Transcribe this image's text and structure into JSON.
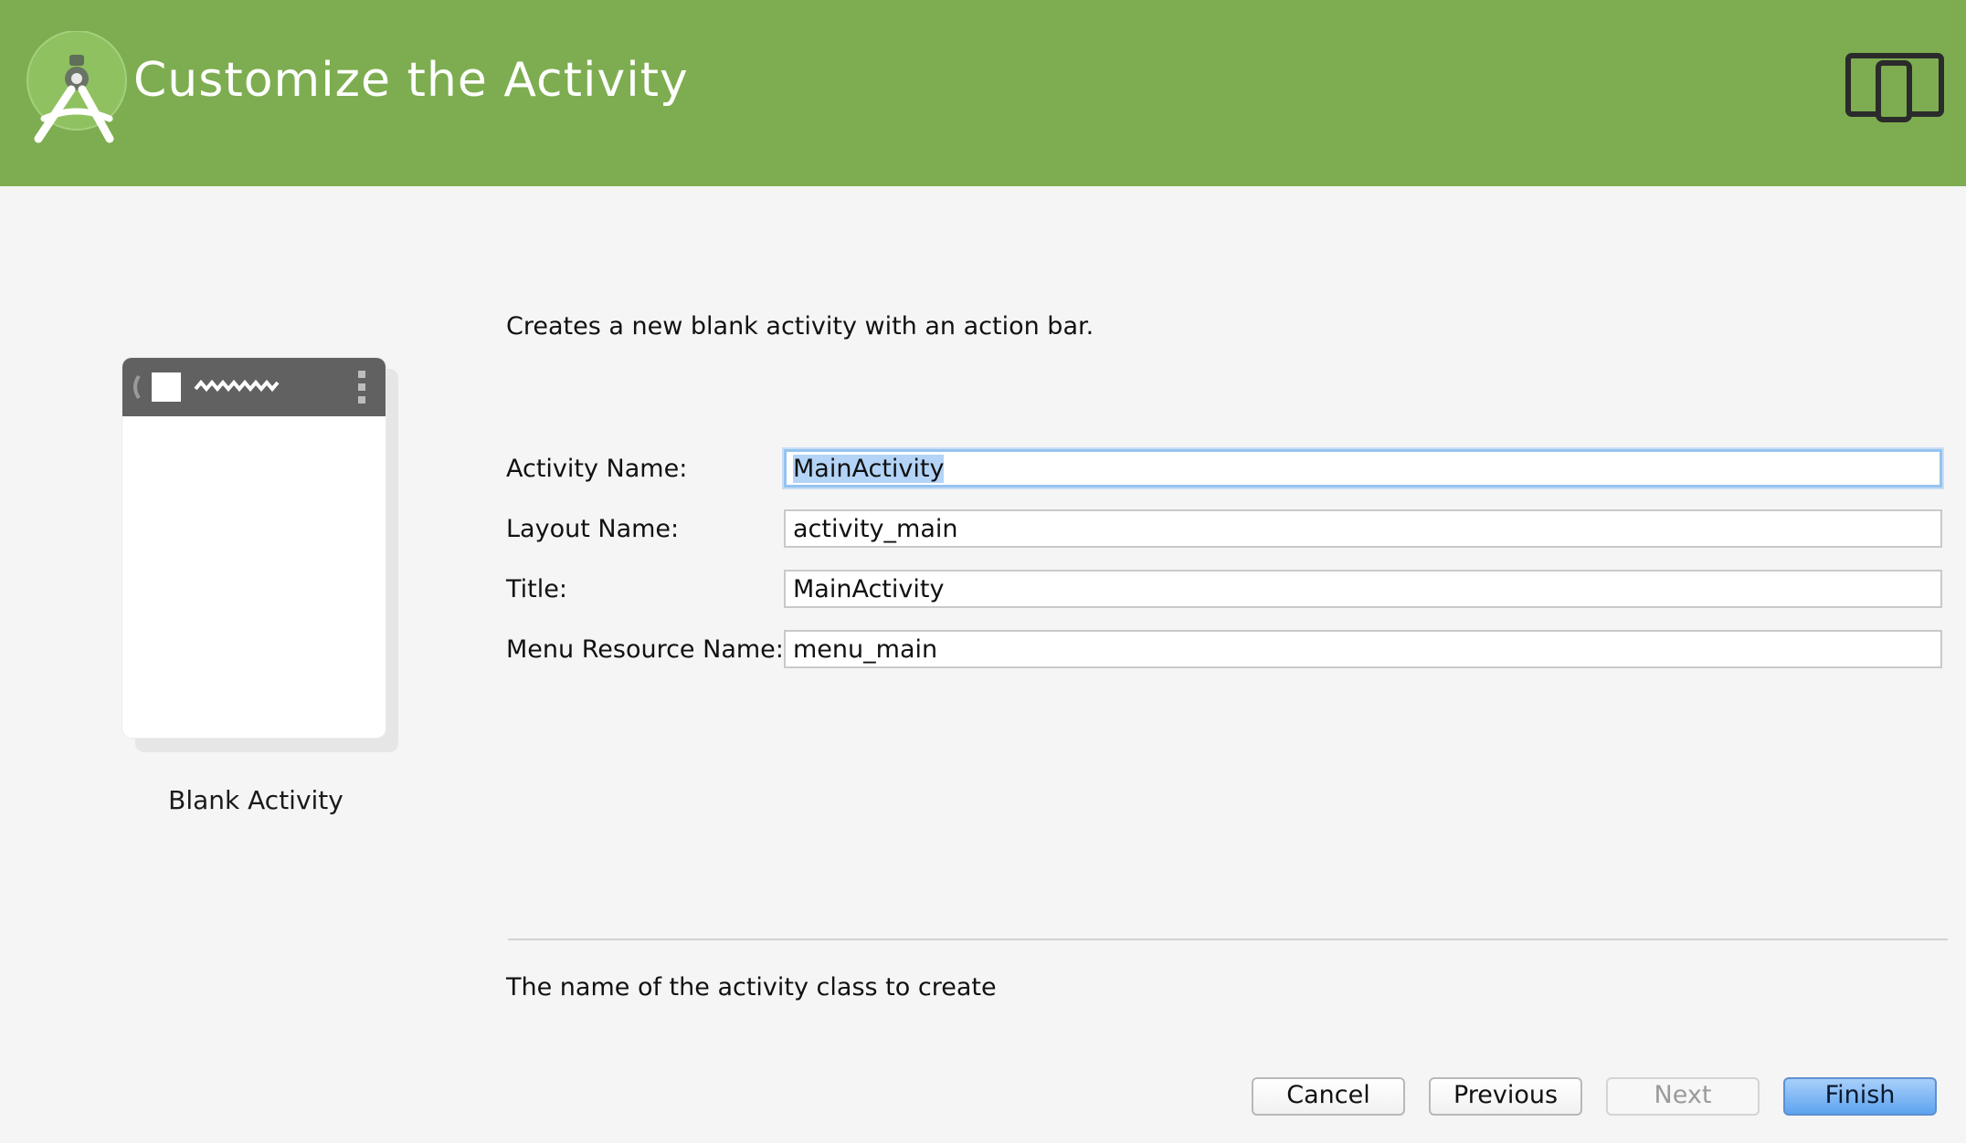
{
  "header": {
    "title": "Customize the Activity",
    "background_color": "#7dad50",
    "logo_icon": "android-studio-logo-icon",
    "device_icon": "tablet-phone-icon"
  },
  "preview": {
    "caption": "Blank Activity"
  },
  "description": "Creates a new blank activity with an action bar.",
  "form": {
    "fields": [
      {
        "label": "Activity Name:",
        "value": "MainActivity",
        "focused": true
      },
      {
        "label": "Layout Name:",
        "value": "activity_main"
      },
      {
        "label": "Title:",
        "value": "MainActivity"
      },
      {
        "label": "Menu Resource Name:",
        "value": "menu_main"
      }
    ]
  },
  "help_text": "The name of the activity class to create",
  "buttons": {
    "cancel": "Cancel",
    "previous": "Previous",
    "next": "Next",
    "finish": "Finish"
  }
}
